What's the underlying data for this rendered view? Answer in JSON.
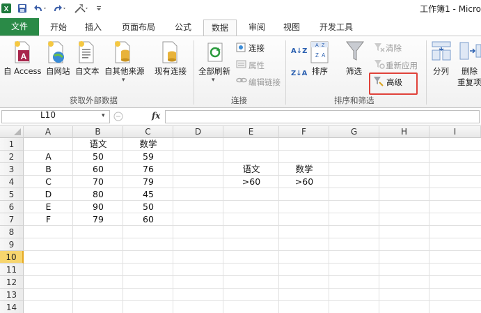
{
  "window": {
    "title": "工作簿1 - Micro"
  },
  "tabs": [
    {
      "label": "文件",
      "active": false
    },
    {
      "label": "开始",
      "active": false
    },
    {
      "label": "插入",
      "active": false
    },
    {
      "label": "页面布局",
      "active": false
    },
    {
      "label": "公式",
      "active": false
    },
    {
      "label": "数据",
      "active": true
    },
    {
      "label": "审阅",
      "active": false
    },
    {
      "label": "视图",
      "active": false
    },
    {
      "label": "开发工具",
      "active": false
    }
  ],
  "ribbon": {
    "get_external": {
      "access": "自 Access",
      "web": "自网站",
      "text": "自文本",
      "other": "自其他来源",
      "existing": "现有连接",
      "group_label": "获取外部数据"
    },
    "connections": {
      "refresh_all": "全部刷新",
      "connections": "连接",
      "properties": "属性",
      "edit_links": "编辑链接",
      "group_label": "连接"
    },
    "sort_filter": {
      "sort": "排序",
      "filter": "筛选",
      "clear": "清除",
      "reapply": "重新应用",
      "advanced": "高级",
      "group_label": "排序和筛选",
      "sort_az_glyph": "A↓Z",
      "sort_za_glyph": "Z↓A"
    },
    "data_tools": {
      "split": "分列",
      "remove": "删除",
      "duplicates": "重复项"
    }
  },
  "formula_bar": {
    "name_box": "L10",
    "fx": "fx",
    "value": ""
  },
  "grid": {
    "columns": [
      "A",
      "B",
      "C",
      "D",
      "E",
      "F",
      "G",
      "H",
      "I"
    ],
    "rows": [
      "1",
      "2",
      "3",
      "4",
      "5",
      "6",
      "7",
      "8",
      "9",
      "10",
      "11",
      "12",
      "13",
      "14"
    ],
    "selected_row": "10",
    "cells": {
      "B1": "语文",
      "C1": "数学",
      "A2": "A",
      "B2": "50",
      "C2": "59",
      "A3": "B",
      "B3": "60",
      "C3": "76",
      "A4": "C",
      "B4": "70",
      "C4": "79",
      "A5": "D",
      "B5": "80",
      "C5": "45",
      "A6": "E",
      "B6": "90",
      "C6": "50",
      "A7": "F",
      "B7": "79",
      "C7": "60",
      "E3": "语文",
      "F3": "数学",
      "E4": ">60",
      "F4": ">60"
    }
  },
  "accent": {
    "file_tab": "#2a8a47",
    "highlight_box": "#e0423a",
    "selected_row": "#f7d56e"
  }
}
